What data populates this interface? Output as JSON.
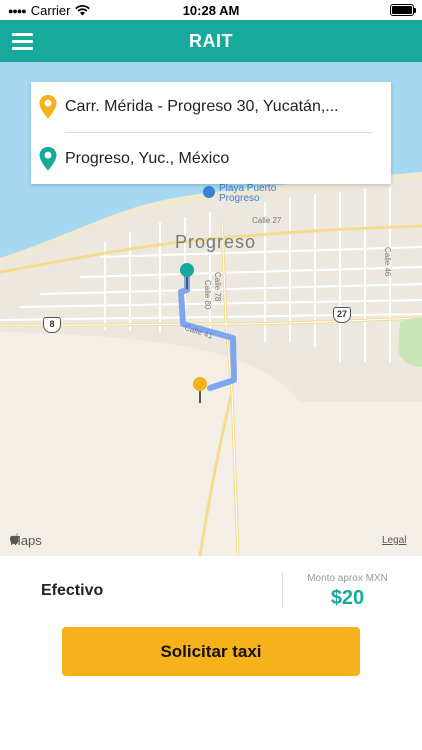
{
  "status_bar": {
    "carrier": "Carrier",
    "time": "10:28 AM"
  },
  "nav": {
    "title": "RAIT",
    "menu_icon": "hamburger-menu-icon"
  },
  "route": {
    "origin": "Carr. Mérida - Progreso 30, Yucatán,...",
    "destination": "Progreso, Yuc., México",
    "origin_icon": "location-pin-icon",
    "destination_icon": "location-pin-icon",
    "origin_color": "#f6b11b",
    "destination_color": "#17a99b"
  },
  "map": {
    "city": "Progreso",
    "beach": "Playa Puerto Progreso",
    "beach_line1": "Playa Puerto",
    "beach_line2": "Progreso",
    "streets": {
      "c27": "Calle 27",
      "c46": "Calle 46",
      "c78": "Calle 78",
      "c80": "Calle 80",
      "c41": "Calle 41"
    },
    "shields": {
      "h8": "8",
      "h27": "27"
    },
    "attribution": "Maps",
    "legal": "Legal"
  },
  "ride": {
    "payment_method": "Efectivo",
    "fare_label": "Monto aprox MXN",
    "fare_value": "$20"
  },
  "actions": {
    "request_label": "Solicitar taxi"
  },
  "colors": {
    "primary": "#17a99b",
    "accent": "#f6b11b",
    "route": "#7ea6f0"
  }
}
